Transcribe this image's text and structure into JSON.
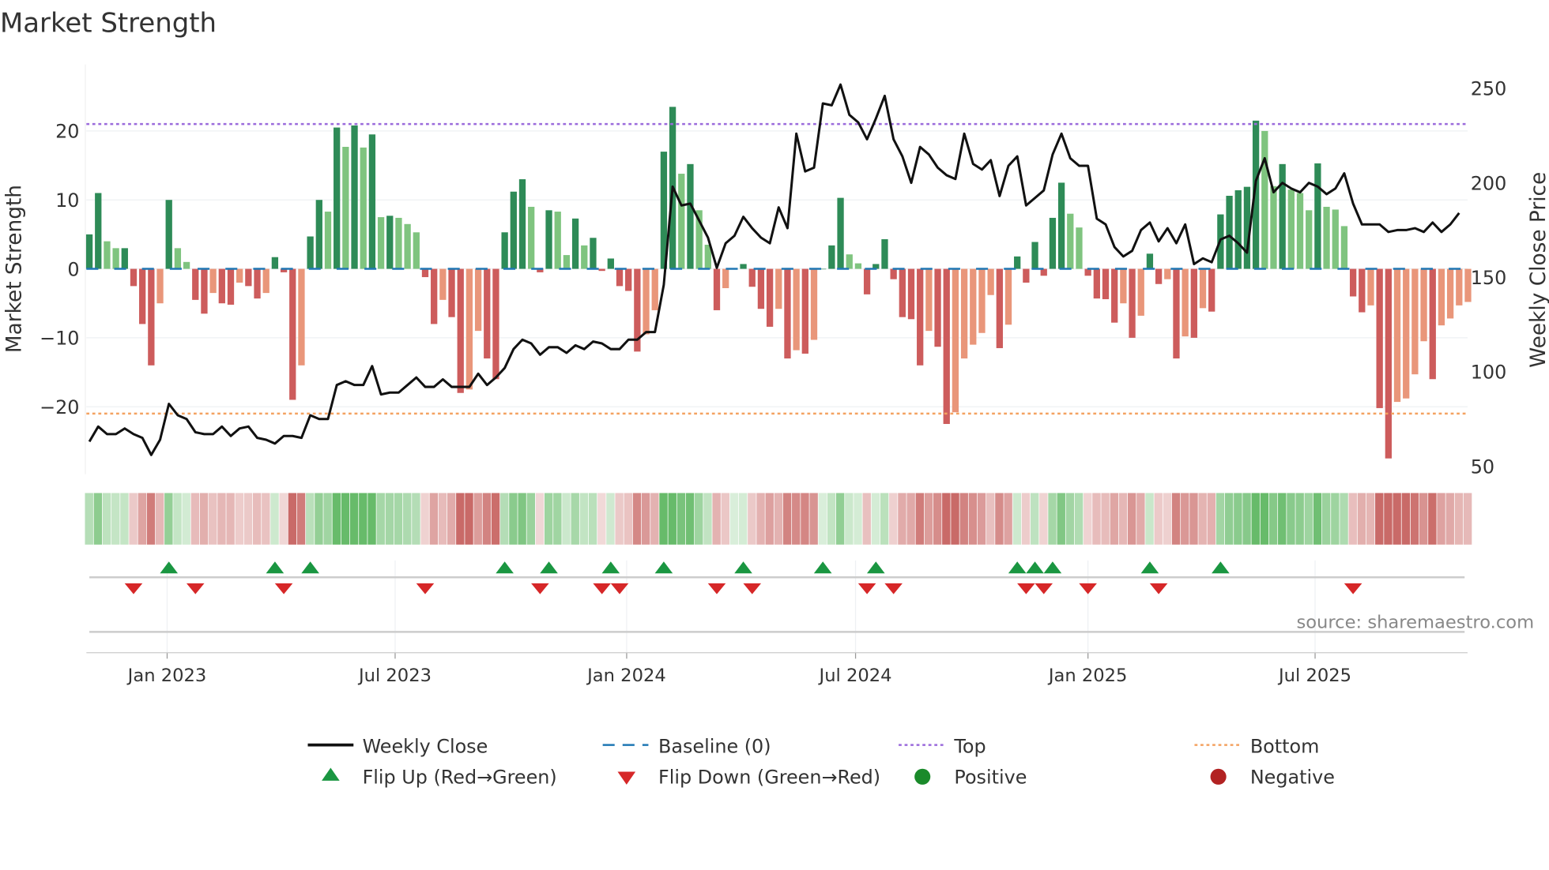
{
  "chart_data": {
    "type": "bar",
    "title": "Market Strength",
    "ylabel": "Market Strength",
    "y2label": "Weekly Close Price",
    "ylim": [
      -28,
      29
    ],
    "y2lim": [
      45,
      262
    ],
    "yticks": [
      -20,
      -10,
      0,
      10,
      20
    ],
    "y2ticks": [
      50,
      100,
      150,
      200,
      250
    ],
    "x_unit": "week index",
    "xticks": [
      {
        "week": 8.8,
        "label": "Jan 2023"
      },
      {
        "week": 34.6,
        "label": "Jul 2023"
      },
      {
        "week": 60.8,
        "label": "Jan 2024"
      },
      {
        "week": 86.7,
        "label": "Jul 2024"
      },
      {
        "week": 113,
        "label": "Jan 2025"
      },
      {
        "week": 138.7,
        "label": "Jul 2025"
      }
    ],
    "top_level": 21,
    "bottom_level": -21,
    "baseline": 0,
    "strength": [
      5,
      11,
      4,
      3,
      3,
      -2.5,
      -8,
      -14,
      -5,
      10,
      3,
      1,
      -4.5,
      -6.5,
      -3.5,
      -5,
      -5.2,
      -2,
      -2.5,
      -4.3,
      -3.5,
      1.7,
      -0.5,
      -19,
      -14,
      4.7,
      10,
      8.3,
      20.5,
      17.7,
      20.8,
      17.6,
      19.5,
      7.5,
      7.7,
      7.4,
      6.5,
      5.3,
      -1.2,
      -8,
      -4.5,
      -7,
      -18,
      -17.5,
      -9,
      -13,
      -16,
      5.3,
      11.2,
      13,
      9,
      -0.5,
      8.5,
      8.3,
      2,
      7.3,
      3.4,
      4.5,
      -0.3,
      1.5,
      -2.5,
      -3.2,
      -12,
      -9.5,
      -6,
      17,
      23.5,
      13.8,
      15.2,
      8.5,
      3.5,
      -6,
      -2.8,
      0,
      0.7,
      -2.6,
      -5.8,
      -8.4,
      -5.8,
      -13,
      -11.8,
      -12.3,
      -10.3,
      0,
      3.4,
      10.3,
      2.1,
      0.8,
      -3.7,
      0.7,
      4.3,
      -1.5,
      -7,
      -7.3,
      -14,
      -9,
      -11.3,
      -22.5,
      -20.8,
      -13,
      -11,
      -9.3,
      -3.8,
      -11.5,
      -8.1,
      1.8,
      -2,
      3.9,
      -1,
      7.4,
      12.5,
      8,
      6,
      -1,
      -4.3,
      -4.4,
      -7.8,
      -5,
      -10,
      -6.8,
      2.2,
      -2.2,
      -1.5,
      -13,
      -9.8,
      -10,
      -5.7,
      -6.2,
      7.9,
      10.6,
      11.4,
      11.9,
      21.5,
      20,
      12,
      15.2,
      11.5,
      11,
      8.5,
      15.3,
      9,
      8.6,
      6.2,
      -4,
      -6.3,
      -5.3,
      -20.2,
      -27.5,
      -19.3,
      -18.8,
      -15.3,
      -10.5,
      -16,
      -8.2,
      -7.2,
      -5.3,
      -4.8
    ],
    "weekly_close": [
      63,
      71,
      67,
      67,
      70,
      67,
      65,
      56,
      64,
      83,
      77,
      75,
      68,
      67,
      67,
      71,
      66,
      70,
      71,
      65,
      64,
      62,
      66,
      66,
      65,
      77,
      75,
      75,
      93,
      95,
      93,
      93,
      103,
      88,
      89,
      89,
      93,
      97,
      92,
      92,
      96,
      92,
      92,
      92,
      99,
      93,
      97,
      102,
      112,
      117,
      115,
      109,
      113,
      113,
      110,
      114,
      112,
      116,
      115,
      112,
      112,
      117,
      117,
      121,
      121,
      146,
      198,
      188,
      189,
      180,
      171,
      155,
      168,
      172,
      182,
      176,
      171,
      168,
      187,
      176,
      226,
      206,
      208,
      242,
      241,
      252,
      236,
      232,
      223,
      234,
      246,
      223,
      214,
      200,
      219,
      215,
      208,
      204,
      202,
      226,
      210,
      207,
      212,
      193,
      209,
      214,
      188,
      192,
      196,
      215,
      226,
      213,
      209,
      209,
      181,
      178,
      166,
      161,
      164,
      175,
      179,
      169,
      176,
      168,
      178,
      157,
      160,
      158,
      170,
      172,
      168,
      163,
      201,
      213,
      195,
      200,
      197,
      195,
      200,
      198,
      194,
      197,
      205,
      189,
      178,
      178,
      178,
      174,
      175,
      175,
      176,
      174,
      179,
      174,
      178,
      184
    ],
    "flip_up_weeks": [
      9,
      21,
      25,
      47,
      52,
      59,
      65,
      74,
      83,
      89,
      105,
      107,
      109,
      120,
      128
    ],
    "flip_down_weeks": [
      5,
      12,
      22,
      38,
      51,
      58,
      60,
      71,
      75,
      88,
      91,
      106,
      108,
      113,
      121,
      143
    ],
    "legend": {
      "weekly_close": "Weekly Close",
      "baseline": "Baseline (0)",
      "top": "Top",
      "bottom": "Bottom",
      "flip_up": "Flip Up (Red→Green)",
      "flip_down": "Flip Down (Green→Red)",
      "positive": "Positive",
      "negative": "Negative"
    },
    "legend_position": "bottom",
    "grid": true
  },
  "source": "source: sharemaestro.com",
  "colors": {
    "green_dark": "#2e8b57",
    "green_light": "#7fc47f",
    "red_dark": "#cd5c5c",
    "red_light": "#e9967a",
    "top": "#9b6bdc",
    "bottom": "#f4a261",
    "baseline": "#1f77b4",
    "flip_up": "#1a9641",
    "flip_down": "#d62728",
    "positive": "#1a8a2a",
    "negative": "#b22222"
  }
}
